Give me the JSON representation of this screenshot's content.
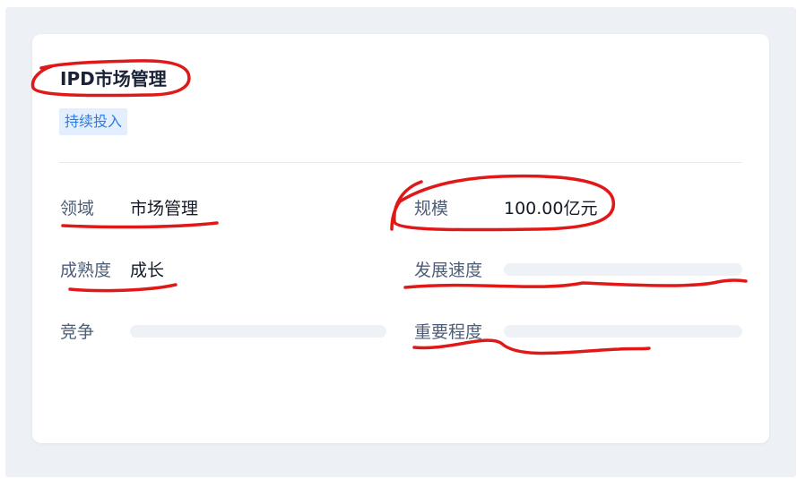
{
  "card": {
    "title": "IPD市场管理",
    "tag": "持续投入"
  },
  "fields": {
    "domain": {
      "label": "领域",
      "value": "市场管理"
    },
    "scale": {
      "label": "规模",
      "value": "100.00亿元"
    },
    "maturity": {
      "label": "成熟度",
      "value": "成长"
    },
    "growth_speed": {
      "label": "发展速度"
    },
    "competition": {
      "label": "竞争"
    },
    "importance": {
      "label": "重要程度"
    }
  },
  "colors": {
    "title": "#1a2236",
    "tag_bg": "#e3efff",
    "tag_text": "#2b7ce9",
    "label": "#4e5e78",
    "value": "#141a26",
    "annotation": "#e01818"
  }
}
